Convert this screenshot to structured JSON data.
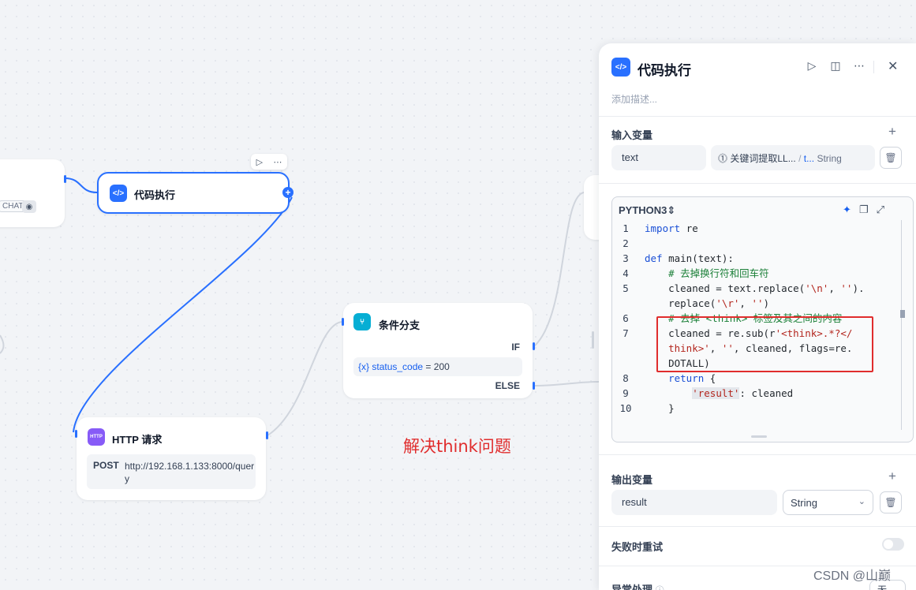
{
  "left_node": {
    "tag": "CHAT"
  },
  "code_node": {
    "title": "代码执行",
    "icon_text": "</>"
  },
  "condition_node": {
    "title": "条件分支",
    "if_label": "IF",
    "else_label": "ELSE",
    "condition_var_prefix": "{x}",
    "condition_var": "status_code",
    "condition_op": "=",
    "condition_value": "200"
  },
  "http_node": {
    "title": "HTTP 请求",
    "icon_text": "HTTP",
    "method": "POST",
    "url": "http://192.168.1.133:8000/query"
  },
  "annotation": "解决think问题",
  "panel": {
    "title": "代码执行",
    "description_placeholder": "添加描述...",
    "input_section": "输入变量",
    "input_var_name": "text",
    "input_var_source": "关键词提取LL...",
    "input_var_sep": "/",
    "input_var_field": "t...",
    "input_var_type": "String",
    "language": "PYTHON3",
    "output_section": "输出变量",
    "output_var_name": "result",
    "output_var_type": "String",
    "retry_label": "失败时重试",
    "exception_label": "异常处理",
    "exception_value": "无"
  },
  "code_lines": [
    {
      "n": "1",
      "segments": [
        [
          "kw",
          "import"
        ],
        [
          "",
          "re"
        ]
      ]
    },
    {
      "n": "2",
      "segments": []
    },
    {
      "n": "3",
      "segments": [
        [
          "kw",
          "def"
        ],
        [
          "",
          "main(text):"
        ]
      ]
    },
    {
      "n": "4",
      "segments": [
        [
          "cm",
          "    # 去掉换行符和回车符"
        ]
      ]
    },
    {
      "n": "5",
      "segments": [
        [
          "",
          "    cleaned = text.replace("
        ],
        [
          "st",
          "'\\n'"
        ],
        [
          "",
          ", "
        ],
        [
          "st",
          "''"
        ],
        [
          "",
          ")."
        ]
      ]
    },
    {
      "n": "",
      "segments": [
        [
          "",
          "    replace("
        ],
        [
          "st",
          "'\\r'"
        ],
        [
          "",
          ", "
        ],
        [
          "st",
          "''"
        ],
        [
          "",
          ")"
        ]
      ]
    },
    {
      "n": "6",
      "segments": [
        [
          "cm",
          "    # 去掉 <think> 标签及其之间的内容"
        ]
      ]
    },
    {
      "n": "7",
      "segments": [
        [
          "",
          "    cleaned = re.sub(r"
        ],
        [
          "st",
          "'<think>.*?</"
        ]
      ]
    },
    {
      "n": "",
      "segments": [
        [
          "st",
          "    think>'"
        ],
        [
          "",
          ", "
        ],
        [
          "st",
          "''"
        ],
        [
          "",
          ", cleaned, flags=re."
        ]
      ]
    },
    {
      "n": "",
      "segments": [
        [
          "",
          "    DOTALL)"
        ]
      ]
    },
    {
      "n": "8",
      "segments": [
        [
          "kw",
          "    return"
        ],
        [
          "",
          "{"
        ]
      ]
    },
    {
      "n": "9",
      "segments": [
        [
          "",
          "        "
        ],
        [
          "st hl",
          "'result'"
        ],
        [
          "",
          ": cleaned"
        ]
      ]
    },
    {
      "n": "10",
      "segments": [
        [
          "",
          "    }"
        ]
      ]
    }
  ],
  "watermark": "CSDN @山巅",
  "colors": {
    "accent": "#2970ff",
    "annotation": "#e02d2d",
    "condition": "#06aed4",
    "http": "#875bf7"
  }
}
